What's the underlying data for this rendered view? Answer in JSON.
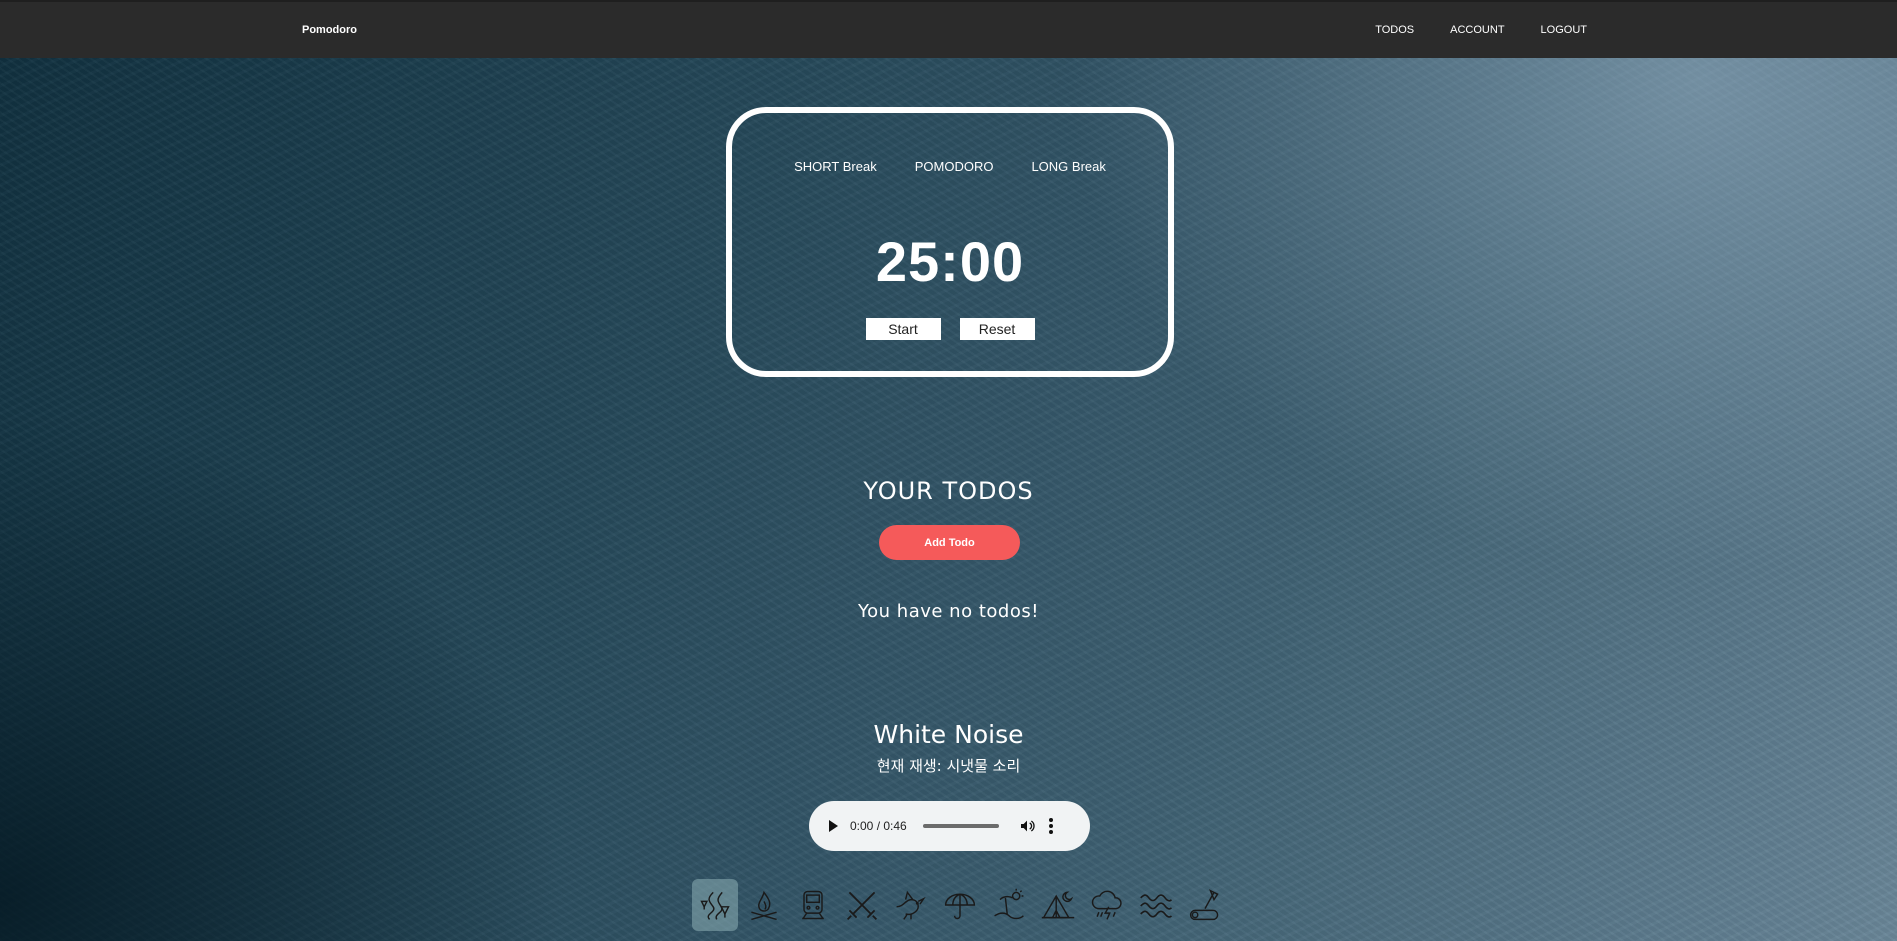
{
  "navbar": {
    "brand": "Pomodoro",
    "links": [
      "TODOS",
      "ACCOUNT",
      "LOGOUT"
    ]
  },
  "timer": {
    "modes": [
      "SHORT Break",
      "POMODORO",
      "LONG Break"
    ],
    "time": "25:00",
    "start_label": "Start",
    "reset_label": "Reset"
  },
  "todos": {
    "title": "YOUR TODOS",
    "add_label": "Add Todo",
    "empty_message": "You have no todos!"
  },
  "white_noise": {
    "title": "White Noise",
    "now_playing": "현재 재생: 시냇물 소리",
    "player": {
      "time": "0:00 / 0:46",
      "progress": 0
    },
    "sounds": [
      {
        "icon": "stream-icon",
        "active": true
      },
      {
        "icon": "campfire-icon",
        "active": false
      },
      {
        "icon": "train-icon",
        "active": false
      },
      {
        "icon": "swords-icon",
        "active": false
      },
      {
        "icon": "bird-icon",
        "active": false
      },
      {
        "icon": "umbrella-icon",
        "active": false
      },
      {
        "icon": "beach-icon",
        "active": false
      },
      {
        "icon": "camping-icon",
        "active": false
      },
      {
        "icon": "thunderstorm-icon",
        "active": false
      },
      {
        "icon": "waves-icon",
        "active": false
      },
      {
        "icon": "wood-chopping-icon",
        "active": false
      }
    ]
  },
  "colors": {
    "navbar": "#2b2b2b",
    "accent": "#f55a5a",
    "player_bg": "#f1f3f4"
  }
}
